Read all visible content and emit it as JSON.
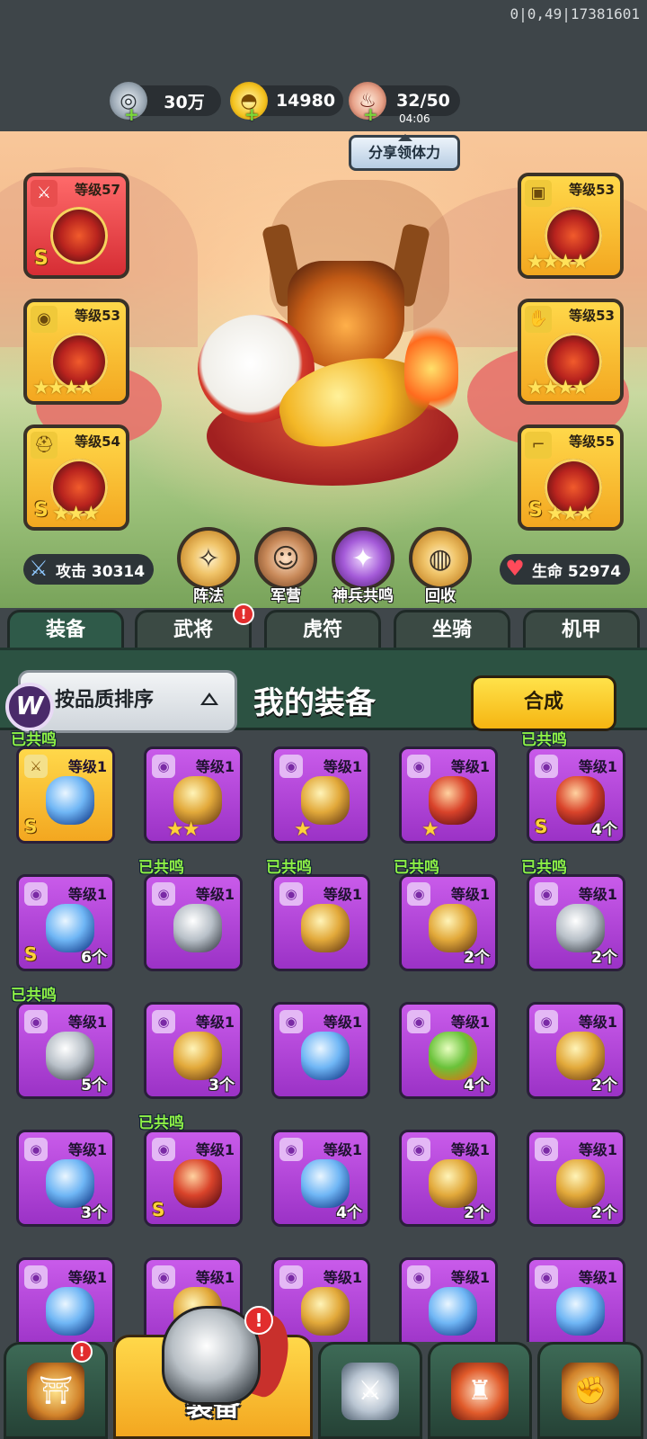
{
  "debug_text": "0|0,49|17381601",
  "resources": {
    "silver": {
      "value": "30万"
    },
    "gold": {
      "value": "14980"
    },
    "stamina": {
      "value": "32/50",
      "timer": "04:06"
    }
  },
  "share_button": "分享领体力",
  "equipped": {
    "left": [
      {
        "level": "等级57",
        "grade": "S",
        "stars": "",
        "style": "red"
      },
      {
        "level": "等级53",
        "grade": "",
        "stars": "★★★★",
        "style": "gold"
      },
      {
        "level": "等级54",
        "grade": "S",
        "stars": "★★★",
        "style": "gold"
      }
    ],
    "right": [
      {
        "level": "等级53",
        "grade": "",
        "stars": "★★★★",
        "style": "gold"
      },
      {
        "level": "等级53",
        "grade": "",
        "stars": "★★★★",
        "style": "gold"
      },
      {
        "level": "等级55",
        "grade": "S",
        "stars": "★★★",
        "style": "gold"
      }
    ]
  },
  "stats": {
    "attack": "攻击 30314",
    "hp": "生命 52974"
  },
  "functions": [
    "阵法",
    "军营",
    "神兵共鸣",
    "回收"
  ],
  "tabs": [
    {
      "label": "装备",
      "active": true,
      "badge": false
    },
    {
      "label": "武将",
      "active": false,
      "badge": true
    },
    {
      "label": "虎符",
      "active": false,
      "badge": false
    },
    {
      "label": "坐骑",
      "active": false,
      "badge": false
    },
    {
      "label": "机甲",
      "active": false,
      "badge": false
    }
  ],
  "badge_mark": "!",
  "toolbar": {
    "sort_label": "按品质排序",
    "title": "我的装备",
    "synth_label": "合成"
  },
  "resonated_label": "已共鸣",
  "level_label": "等级1",
  "items": [
    {
      "resonated": true,
      "style": "gold",
      "art": "blue",
      "grade": "S",
      "stars": "",
      "count": ""
    },
    {
      "resonated": false,
      "style": "purple",
      "art": "gold",
      "grade": "",
      "stars": "★★",
      "count": ""
    },
    {
      "resonated": false,
      "style": "purple",
      "art": "gold",
      "grade": "",
      "stars": "★",
      "count": ""
    },
    {
      "resonated": false,
      "style": "purple",
      "art": "red",
      "grade": "",
      "stars": "★",
      "count": ""
    },
    {
      "resonated": true,
      "style": "purple",
      "art": "red",
      "grade": "S",
      "stars": "",
      "count": "4个"
    },
    {
      "resonated": false,
      "style": "purple",
      "art": "blue",
      "grade": "S",
      "stars": "",
      "count": "6个"
    },
    {
      "resonated": true,
      "style": "purple",
      "art": "silver",
      "grade": "",
      "stars": "",
      "count": ""
    },
    {
      "resonated": true,
      "style": "purple",
      "art": "gold",
      "grade": "",
      "stars": "",
      "count": ""
    },
    {
      "resonated": true,
      "style": "purple",
      "art": "gold",
      "grade": "",
      "stars": "",
      "count": "2个"
    },
    {
      "resonated": true,
      "style": "purple",
      "art": "silver",
      "grade": "",
      "stars": "",
      "count": "2个"
    },
    {
      "resonated": true,
      "style": "purple",
      "art": "silver",
      "grade": "",
      "stars": "",
      "count": "5个"
    },
    {
      "resonated": false,
      "style": "purple",
      "art": "gold",
      "grade": "",
      "stars": "",
      "count": "3个"
    },
    {
      "resonated": false,
      "style": "purple",
      "art": "blue",
      "grade": "",
      "stars": "",
      "count": ""
    },
    {
      "resonated": false,
      "style": "purple",
      "art": "green",
      "grade": "",
      "stars": "",
      "count": "4个"
    },
    {
      "resonated": false,
      "style": "purple",
      "art": "gold",
      "grade": "",
      "stars": "",
      "count": "2个"
    },
    {
      "resonated": false,
      "style": "purple",
      "art": "blue",
      "grade": "",
      "stars": "",
      "count": "3个"
    },
    {
      "resonated": true,
      "style": "purple",
      "art": "red",
      "grade": "S",
      "stars": "",
      "count": ""
    },
    {
      "resonated": false,
      "style": "purple",
      "art": "blue",
      "grade": "",
      "stars": "",
      "count": "4个"
    },
    {
      "resonated": false,
      "style": "purple",
      "art": "gold",
      "grade": "",
      "stars": "",
      "count": "2个"
    },
    {
      "resonated": false,
      "style": "purple",
      "art": "gold",
      "grade": "",
      "stars": "",
      "count": "2个"
    },
    {
      "resonated": false,
      "style": "purple",
      "art": "blue",
      "grade": "",
      "stars": "",
      "count": ""
    },
    {
      "resonated": false,
      "style": "purple",
      "art": "gold",
      "grade": "",
      "stars": "",
      "count": ""
    },
    {
      "resonated": false,
      "style": "purple",
      "art": "gold",
      "grade": "",
      "stars": "",
      "count": ""
    },
    {
      "resonated": false,
      "style": "purple",
      "art": "blue",
      "grade": "",
      "stars": "",
      "count": ""
    },
    {
      "resonated": false,
      "style": "purple",
      "art": "blue",
      "grade": "",
      "stars": "",
      "count": ""
    }
  ],
  "bottom_nav": [
    {
      "label": "",
      "icon": "gate-icon",
      "active": false,
      "badge": true
    },
    {
      "label": "装备",
      "icon": "helmet-icon",
      "active": true,
      "badge": true
    },
    {
      "label": "",
      "icon": "crossed-swords-icon",
      "active": false,
      "badge": false
    },
    {
      "label": "",
      "icon": "rooster-icon",
      "active": false,
      "badge": false
    },
    {
      "label": "",
      "icon": "fist-upgrade-icon",
      "active": false,
      "badge": false
    }
  ]
}
